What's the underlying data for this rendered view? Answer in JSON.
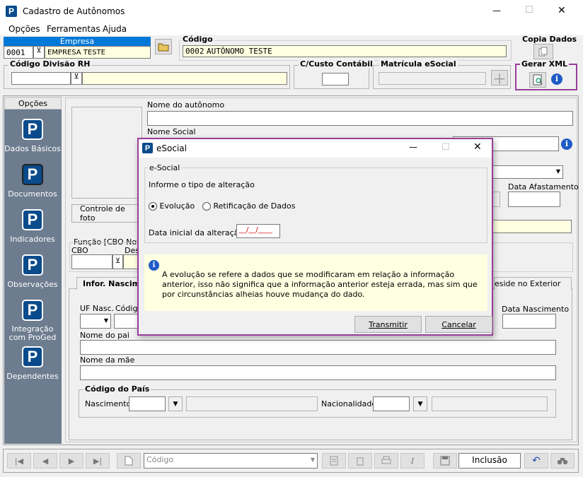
{
  "window": {
    "title": "Cadastro de Autônomos",
    "minimize": "—",
    "maximize": "☐",
    "close": "✕"
  },
  "menu": [
    {
      "label": "Opções"
    },
    {
      "label": "Ferramentas"
    },
    {
      "label": "Ajuda"
    }
  ],
  "empresa": {
    "header": "Empresa",
    "code": "0001",
    "name": "EMPRESA TESTE"
  },
  "codigo": {
    "label": "Código",
    "code": "0002",
    "name": "AUTÔNOMO TESTE"
  },
  "copia_dados": {
    "label": "Copia Dados"
  },
  "divisao_rh": {
    "label": "Código Divisão RH",
    "value": ""
  },
  "custo": {
    "label": "C/Custo Contábil",
    "value": ""
  },
  "matricula": {
    "label": "Matrícula eSocial",
    "value": ""
  },
  "gerar_xml": {
    "label": "Gerar XML"
  },
  "sidebar": {
    "title": "Opções",
    "items": [
      {
        "label": "Dados Básicos"
      },
      {
        "label": "Documentos"
      },
      {
        "label": "Indicadores"
      },
      {
        "label": "Observações"
      },
      {
        "label": "Integração com ProGed"
      },
      {
        "label": "Dependentes"
      }
    ]
  },
  "form": {
    "nome_label": "Nome do autônomo",
    "nome_value": "",
    "nome_social_label": "Nome Social",
    "data_afastamento_label": "Data Afastamento",
    "controle_foto": "Controle de foto",
    "funcao_label": "Função [CBO Novo",
    "cbo_label": "CBO",
    "des_label": "Des",
    "tab_infor": "Infor. Nascim",
    "tab_reside": "eside no Exterior",
    "uf_label": "UF Nasc.",
    "codigo_label": "Código",
    "data_nasc_label": "Data Nascimento",
    "pai_label": "Nome do pai",
    "mae_label": "Nome da mãe",
    "pais_group": "Código do País",
    "nascimento_label": "Nascimento",
    "nacionalidade_label": "Nacionalidade"
  },
  "dialog": {
    "title": "eSocial",
    "group": "e-Social",
    "prompt": "Informe o tipo de alteração",
    "options": [
      {
        "label": "Evolução",
        "selected": true
      },
      {
        "label": "Retificação de Dados",
        "selected": false
      }
    ],
    "date_label": "Data inicial da alteração:",
    "date_value": "__/__/____",
    "info_text": "A evolução se refere a dados que se modificaram em relação a informação anterior, isso não significa que a informação anterior esteja errada, mas sim que por circunstâncias alheias houve mudança do dado.",
    "transmit": "Transmitir",
    "cancel": "Cancelar"
  },
  "bottom": {
    "search_placeholder": "Código",
    "mode": "Inclusão"
  }
}
